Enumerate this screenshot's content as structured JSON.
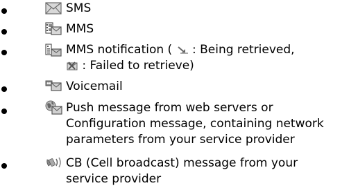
{
  "items": [
    {
      "icon": "envelope-icon",
      "lines": [
        "SMS"
      ]
    },
    {
      "icon": "mms-film-envelope-icon",
      "lines": [
        "MMS"
      ]
    },
    {
      "icon": "mms-notification-icon",
      "line1_before": "MMS notification (",
      "line1_after": ": Being retrieved,",
      "line2_after": ": Failed to retrieve)",
      "retrieving_icon": "downloading-arrow-icon",
      "failed_icon": "failed-envelope-icon"
    },
    {
      "icon": "voicemail-icon",
      "lines": [
        "Voicemail"
      ]
    },
    {
      "icon": "push-message-globe-icon",
      "lines": [
        "Push message from web servers or",
        "Configuration message, containing network",
        "parameters from your service provider"
      ]
    },
    {
      "icon": "cell-broadcast-icon",
      "lines": [
        "CB (Cell broadcast) message from your",
        "service provider"
      ]
    }
  ]
}
